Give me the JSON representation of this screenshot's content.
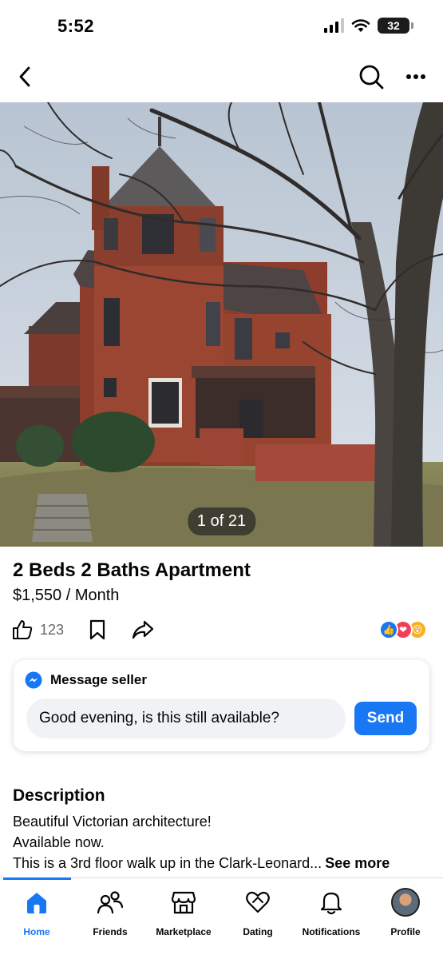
{
  "status_bar": {
    "time": "5:52",
    "battery": "32"
  },
  "top_nav": {
    "back_icon": "chevron-left-icon",
    "search_icon": "search-icon",
    "more_icon": "more-horizontal-icon"
  },
  "hero": {
    "photo_counter": "1 of 21"
  },
  "listing": {
    "title": "2 Beds 2 Baths Apartment",
    "price": "$1,550 / Month",
    "like_count": "123"
  },
  "message_seller": {
    "title": "Message seller",
    "input_value": "Good evening, is this still available?",
    "send_label": "Send"
  },
  "description": {
    "heading": "Description",
    "lines": [
      "Beautiful Victorian architecture!",
      "Available now.",
      "This is a 3rd floor walk up in the Clark-Leonard..."
    ],
    "see_more_label": "See more"
  },
  "tab_bar": {
    "tabs": [
      {
        "label": "Home",
        "icon": "home-icon"
      },
      {
        "label": "Friends",
        "icon": "friends-icon"
      },
      {
        "label": "Marketplace",
        "icon": "marketplace-icon"
      },
      {
        "label": "Dating",
        "icon": "dating-icon"
      },
      {
        "label": "Notifications",
        "icon": "bell-icon"
      },
      {
        "label": "Profile",
        "icon": "avatar"
      }
    ],
    "active_tab": "Home"
  },
  "colors": {
    "accent": "#1877f2",
    "text": "#050505",
    "secondary_text": "#65676b",
    "input_bg": "#f0f2f5"
  }
}
